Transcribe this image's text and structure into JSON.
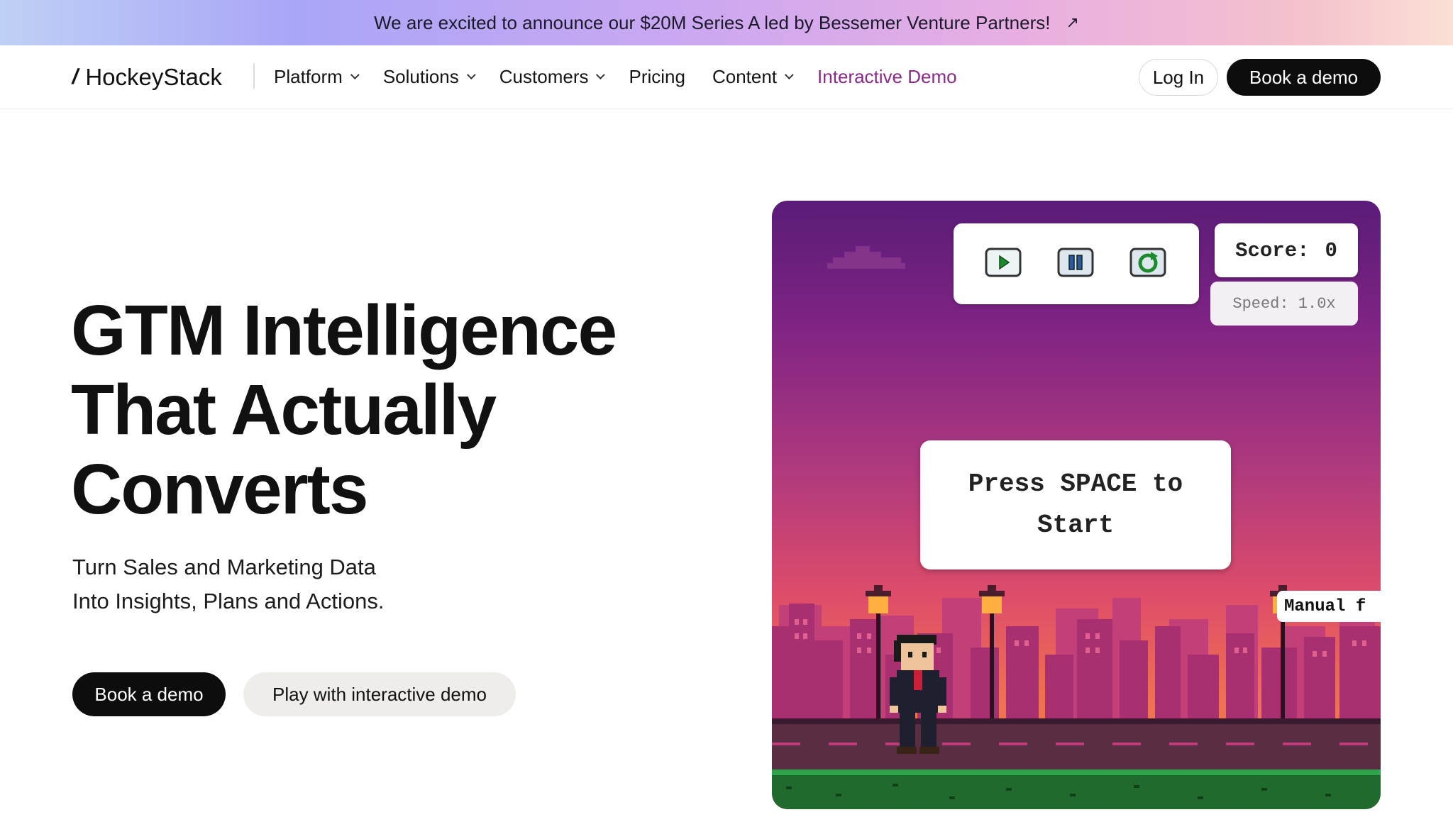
{
  "banner": {
    "text": "We are excited to announce our $20M Series A led by Bessemer Venture Partners!",
    "arrow": "↗"
  },
  "header": {
    "logo_text": "HockeyStack",
    "logo_mark": "/",
    "nav": [
      {
        "label": "Platform",
        "dropdown": true
      },
      {
        "label": "Solutions",
        "dropdown": true
      },
      {
        "label": "Customers",
        "dropdown": true
      },
      {
        "label": "Pricing",
        "dropdown": false
      },
      {
        "label": "Content",
        "dropdown": true
      },
      {
        "label": "Interactive Demo",
        "dropdown": false
      }
    ],
    "login_label": "Log In",
    "book_label": "Book a demo"
  },
  "hero": {
    "title_lines": [
      "GTM Intelligence",
      "That Actually",
      "Converts"
    ],
    "subtitle_lines": [
      "Turn Sales and Marketing Data",
      "Into Insights, Plans and Actions."
    ],
    "cta_primary": "Book a demo",
    "cta_secondary": "Play with interactive demo"
  },
  "game": {
    "score_label": "Score:",
    "score_value": "0",
    "speed_text": "Speed: 1.0x",
    "start_lines": [
      "Press SPACE to",
      "Start"
    ],
    "manual_tag": "Manual f",
    "icons": [
      "play-icon",
      "pause-icon",
      "restart-icon"
    ]
  },
  "colors": {
    "accent_demo": "#8a2a8a",
    "dark_button": "#0d0d0d",
    "secondary_button": "#efedea",
    "control_green": "#1d8a2e"
  }
}
